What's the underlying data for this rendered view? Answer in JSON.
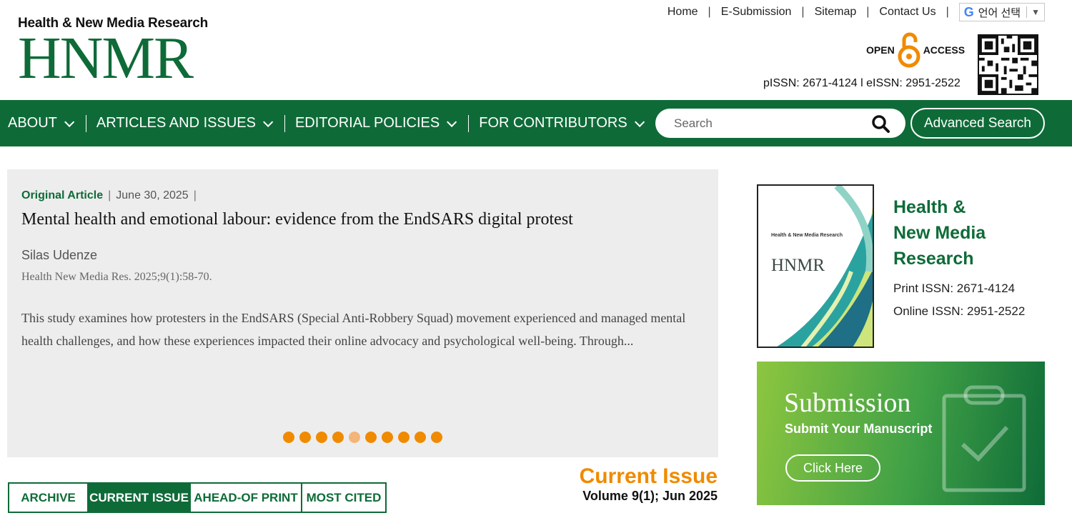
{
  "brand": {
    "subtitle": "Health & New Media Research",
    "logo": "HNMR"
  },
  "top_links": [
    "Home",
    "E-Submission",
    "Sitemap",
    "Contact Us"
  ],
  "translate": {
    "label": "언어 선택",
    "arrow": "▼"
  },
  "open_access": {
    "left": "OPEN",
    "right": "ACCESS"
  },
  "issn_line": "pISSN: 2671-4124 l eISSN: 2951-2522",
  "nav": {
    "items": [
      "ABOUT",
      "ARTICLES AND ISSUES",
      "EDITORIAL POLICIES",
      "FOR CONTRIBUTORS"
    ],
    "search_placeholder": "Search",
    "advanced_search": "Advanced Search"
  },
  "featured": {
    "type": "Original Article",
    "date": "June 30, 2025",
    "title": "Mental health and emotional labour: evidence from the EndSARS digital protest",
    "author": "Silas Udenze",
    "citation": "Health New Media Res. 2025;9(1):58-70.",
    "abstract": "This study examines how protesters in the EndSARS (Special Anti-Robbery Squad) movement experienced and managed mental health challenges, and how these experiences impacted their online advocacy and psychological well-being. Through...",
    "slide_count": 10,
    "active_slide": 4
  },
  "tabs": {
    "items": [
      "ARCHIVE",
      "CURRENT ISSUE",
      "AHEAD-OF PRINT",
      "MOST CITED"
    ],
    "active": 1
  },
  "current_issue": {
    "heading": "Current Issue",
    "volume": "Volume 9(1); Jun 2025"
  },
  "journal": {
    "title_lines": [
      "Health &",
      "New Media",
      "Research"
    ],
    "print_issn": "Print ISSN: 2671-4124",
    "online_issn": "Online ISSN: 2951-2522",
    "cover": {
      "logo": "HNMR",
      "small": "Health & New Media Research"
    }
  },
  "submission": {
    "title": "Submission",
    "subtitle": "Submit Your Manuscript",
    "button": "Click Here"
  },
  "colors": {
    "brand_green": "#0e6b38",
    "accent_orange": "#f08a00",
    "slider_bg": "#ededed"
  }
}
